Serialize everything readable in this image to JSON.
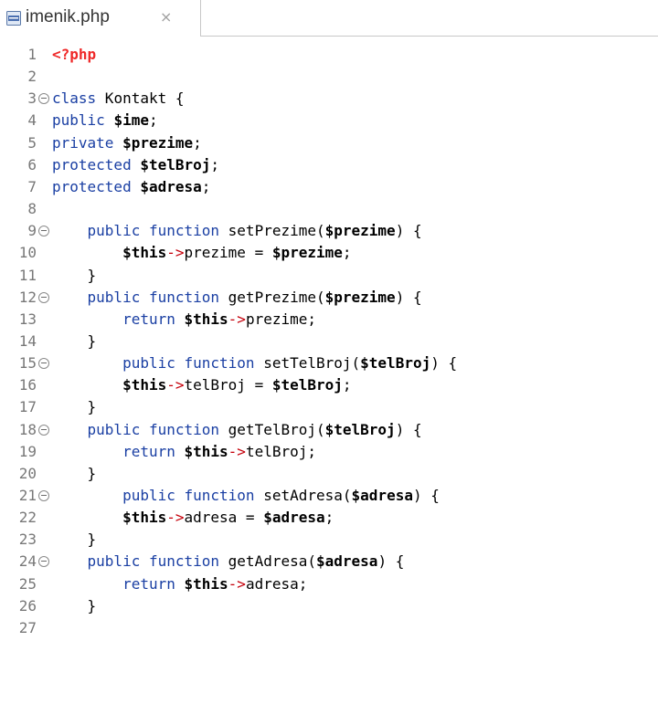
{
  "tab": {
    "title": "imenik.php",
    "close_symbol": "×",
    "file_icon": "php-file-icon"
  },
  "colors": {
    "keyword": "#1a3fa3",
    "variable": "#000000",
    "php_tag": "#ef2929",
    "arrow": "#c5000b",
    "line_number": "#787878"
  },
  "lines": [
    {
      "n": "1",
      "fold": false,
      "tokens": [
        {
          "t": "tag",
          "v": "<?php"
        }
      ]
    },
    {
      "n": "2",
      "fold": false,
      "tokens": []
    },
    {
      "n": "3",
      "fold": true,
      "tokens": [
        {
          "t": "kw",
          "v": "class"
        },
        {
          "t": "plain",
          "v": " Kontakt {"
        }
      ]
    },
    {
      "n": "4",
      "fold": false,
      "tokens": [
        {
          "t": "kw",
          "v": "public"
        },
        {
          "t": "plain",
          "v": " "
        },
        {
          "t": "var",
          "v": "$ime"
        },
        {
          "t": "plain",
          "v": ";"
        }
      ]
    },
    {
      "n": "5",
      "fold": false,
      "tokens": [
        {
          "t": "kw",
          "v": "private"
        },
        {
          "t": "plain",
          "v": " "
        },
        {
          "t": "var",
          "v": "$prezime"
        },
        {
          "t": "plain",
          "v": ";"
        }
      ]
    },
    {
      "n": "6",
      "fold": false,
      "tokens": [
        {
          "t": "kw",
          "v": "protected"
        },
        {
          "t": "plain",
          "v": " "
        },
        {
          "t": "var",
          "v": "$telBroj"
        },
        {
          "t": "plain",
          "v": ";"
        }
      ]
    },
    {
      "n": "7",
      "fold": false,
      "tokens": [
        {
          "t": "kw",
          "v": "protected"
        },
        {
          "t": "plain",
          "v": " "
        },
        {
          "t": "var",
          "v": "$adresa"
        },
        {
          "t": "plain",
          "v": ";"
        }
      ]
    },
    {
      "n": "8",
      "fold": false,
      "tokens": []
    },
    {
      "n": "9",
      "fold": true,
      "tokens": [
        {
          "t": "plain",
          "v": "    "
        },
        {
          "t": "kw",
          "v": "public function"
        },
        {
          "t": "plain",
          "v": " setPrezime("
        },
        {
          "t": "var",
          "v": "$prezime"
        },
        {
          "t": "plain",
          "v": ") {"
        }
      ]
    },
    {
      "n": "10",
      "fold": false,
      "tokens": [
        {
          "t": "plain",
          "v": "        "
        },
        {
          "t": "var",
          "v": "$this"
        },
        {
          "t": "op",
          "v": "->"
        },
        {
          "t": "plain",
          "v": "prezime = "
        },
        {
          "t": "var",
          "v": "$prezime"
        },
        {
          "t": "plain",
          "v": ";"
        }
      ]
    },
    {
      "n": "11",
      "fold": false,
      "tokens": [
        {
          "t": "plain",
          "v": "    }"
        }
      ]
    },
    {
      "n": "12",
      "fold": true,
      "tokens": [
        {
          "t": "plain",
          "v": "    "
        },
        {
          "t": "kw",
          "v": "public function"
        },
        {
          "t": "plain",
          "v": " getPrezime("
        },
        {
          "t": "var",
          "v": "$prezime"
        },
        {
          "t": "plain",
          "v": ") {"
        }
      ]
    },
    {
      "n": "13",
      "fold": false,
      "tokens": [
        {
          "t": "plain",
          "v": "        "
        },
        {
          "t": "kw",
          "v": "return"
        },
        {
          "t": "plain",
          "v": " "
        },
        {
          "t": "var",
          "v": "$this"
        },
        {
          "t": "op",
          "v": "->"
        },
        {
          "t": "plain",
          "v": "prezime;"
        }
      ]
    },
    {
      "n": "14",
      "fold": false,
      "tokens": [
        {
          "t": "plain",
          "v": "    }"
        }
      ]
    },
    {
      "n": "15",
      "fold": true,
      "tokens": [
        {
          "t": "plain",
          "v": "        "
        },
        {
          "t": "kw",
          "v": "public function"
        },
        {
          "t": "plain",
          "v": " setTelBroj("
        },
        {
          "t": "var",
          "v": "$telBroj"
        },
        {
          "t": "plain",
          "v": ") {"
        }
      ]
    },
    {
      "n": "16",
      "fold": false,
      "tokens": [
        {
          "t": "plain",
          "v": "        "
        },
        {
          "t": "var",
          "v": "$this"
        },
        {
          "t": "op",
          "v": "->"
        },
        {
          "t": "plain",
          "v": "telBroj = "
        },
        {
          "t": "var",
          "v": "$telBroj"
        },
        {
          "t": "plain",
          "v": ";"
        }
      ]
    },
    {
      "n": "17",
      "fold": false,
      "tokens": [
        {
          "t": "plain",
          "v": "    }"
        }
      ]
    },
    {
      "n": "18",
      "fold": true,
      "tokens": [
        {
          "t": "plain",
          "v": "    "
        },
        {
          "t": "kw",
          "v": "public function"
        },
        {
          "t": "plain",
          "v": " getTelBroj("
        },
        {
          "t": "var",
          "v": "$telBroj"
        },
        {
          "t": "plain",
          "v": ") {"
        }
      ]
    },
    {
      "n": "19",
      "fold": false,
      "tokens": [
        {
          "t": "plain",
          "v": "        "
        },
        {
          "t": "kw",
          "v": "return"
        },
        {
          "t": "plain",
          "v": " "
        },
        {
          "t": "var",
          "v": "$this"
        },
        {
          "t": "op",
          "v": "->"
        },
        {
          "t": "plain",
          "v": "telBroj;"
        }
      ]
    },
    {
      "n": "20",
      "fold": false,
      "tokens": [
        {
          "t": "plain",
          "v": "    }"
        }
      ]
    },
    {
      "n": "21",
      "fold": true,
      "tokens": [
        {
          "t": "plain",
          "v": "        "
        },
        {
          "t": "kw",
          "v": "public function"
        },
        {
          "t": "plain",
          "v": " setAdresa("
        },
        {
          "t": "var",
          "v": "$adresa"
        },
        {
          "t": "plain",
          "v": ") {"
        }
      ]
    },
    {
      "n": "22",
      "fold": false,
      "tokens": [
        {
          "t": "plain",
          "v": "        "
        },
        {
          "t": "var",
          "v": "$this"
        },
        {
          "t": "op",
          "v": "->"
        },
        {
          "t": "plain",
          "v": "adresa = "
        },
        {
          "t": "var",
          "v": "$adresa"
        },
        {
          "t": "plain",
          "v": ";"
        }
      ]
    },
    {
      "n": "23",
      "fold": false,
      "tokens": [
        {
          "t": "plain",
          "v": "    }"
        }
      ]
    },
    {
      "n": "24",
      "fold": true,
      "tokens": [
        {
          "t": "plain",
          "v": "    "
        },
        {
          "t": "kw",
          "v": "public function"
        },
        {
          "t": "plain",
          "v": " getAdresa("
        },
        {
          "t": "var",
          "v": "$adresa"
        },
        {
          "t": "plain",
          "v": ") {"
        }
      ]
    },
    {
      "n": "25",
      "fold": false,
      "tokens": [
        {
          "t": "plain",
          "v": "        "
        },
        {
          "t": "kw",
          "v": "return"
        },
        {
          "t": "plain",
          "v": " "
        },
        {
          "t": "var",
          "v": "$this"
        },
        {
          "t": "op",
          "v": "->"
        },
        {
          "t": "plain",
          "v": "adresa;"
        }
      ]
    },
    {
      "n": "26",
      "fold": false,
      "tokens": [
        {
          "t": "plain",
          "v": "    }"
        }
      ]
    },
    {
      "n": "27",
      "fold": false,
      "tokens": []
    }
  ]
}
